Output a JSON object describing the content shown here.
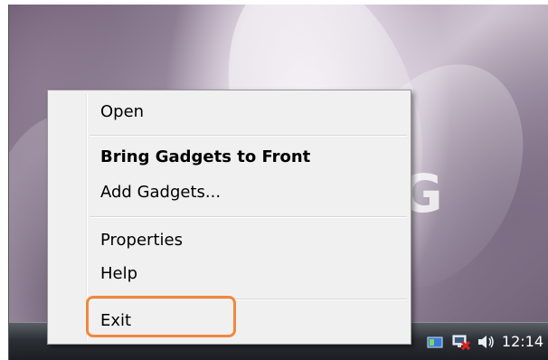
{
  "menu": {
    "items": [
      {
        "label": "Open",
        "bold": false
      },
      {
        "label": "Bring Gadgets to Front",
        "bold": true
      },
      {
        "label": "Add Gadgets...",
        "bold": false
      },
      {
        "label": "Properties",
        "bold": false
      },
      {
        "label": "Help",
        "bold": false
      },
      {
        "label": "Exit",
        "bold": false
      }
    ]
  },
  "wallpaper": {
    "brand_text": "G"
  },
  "taskbar": {
    "clock": "12:14",
    "tray_icons": [
      "network-disconnected-icon",
      "volume-icon"
    ]
  },
  "colors": {
    "highlight": "#f0883e",
    "menu_background": "#f0f0f0",
    "taskbar": "#1b1e22"
  }
}
